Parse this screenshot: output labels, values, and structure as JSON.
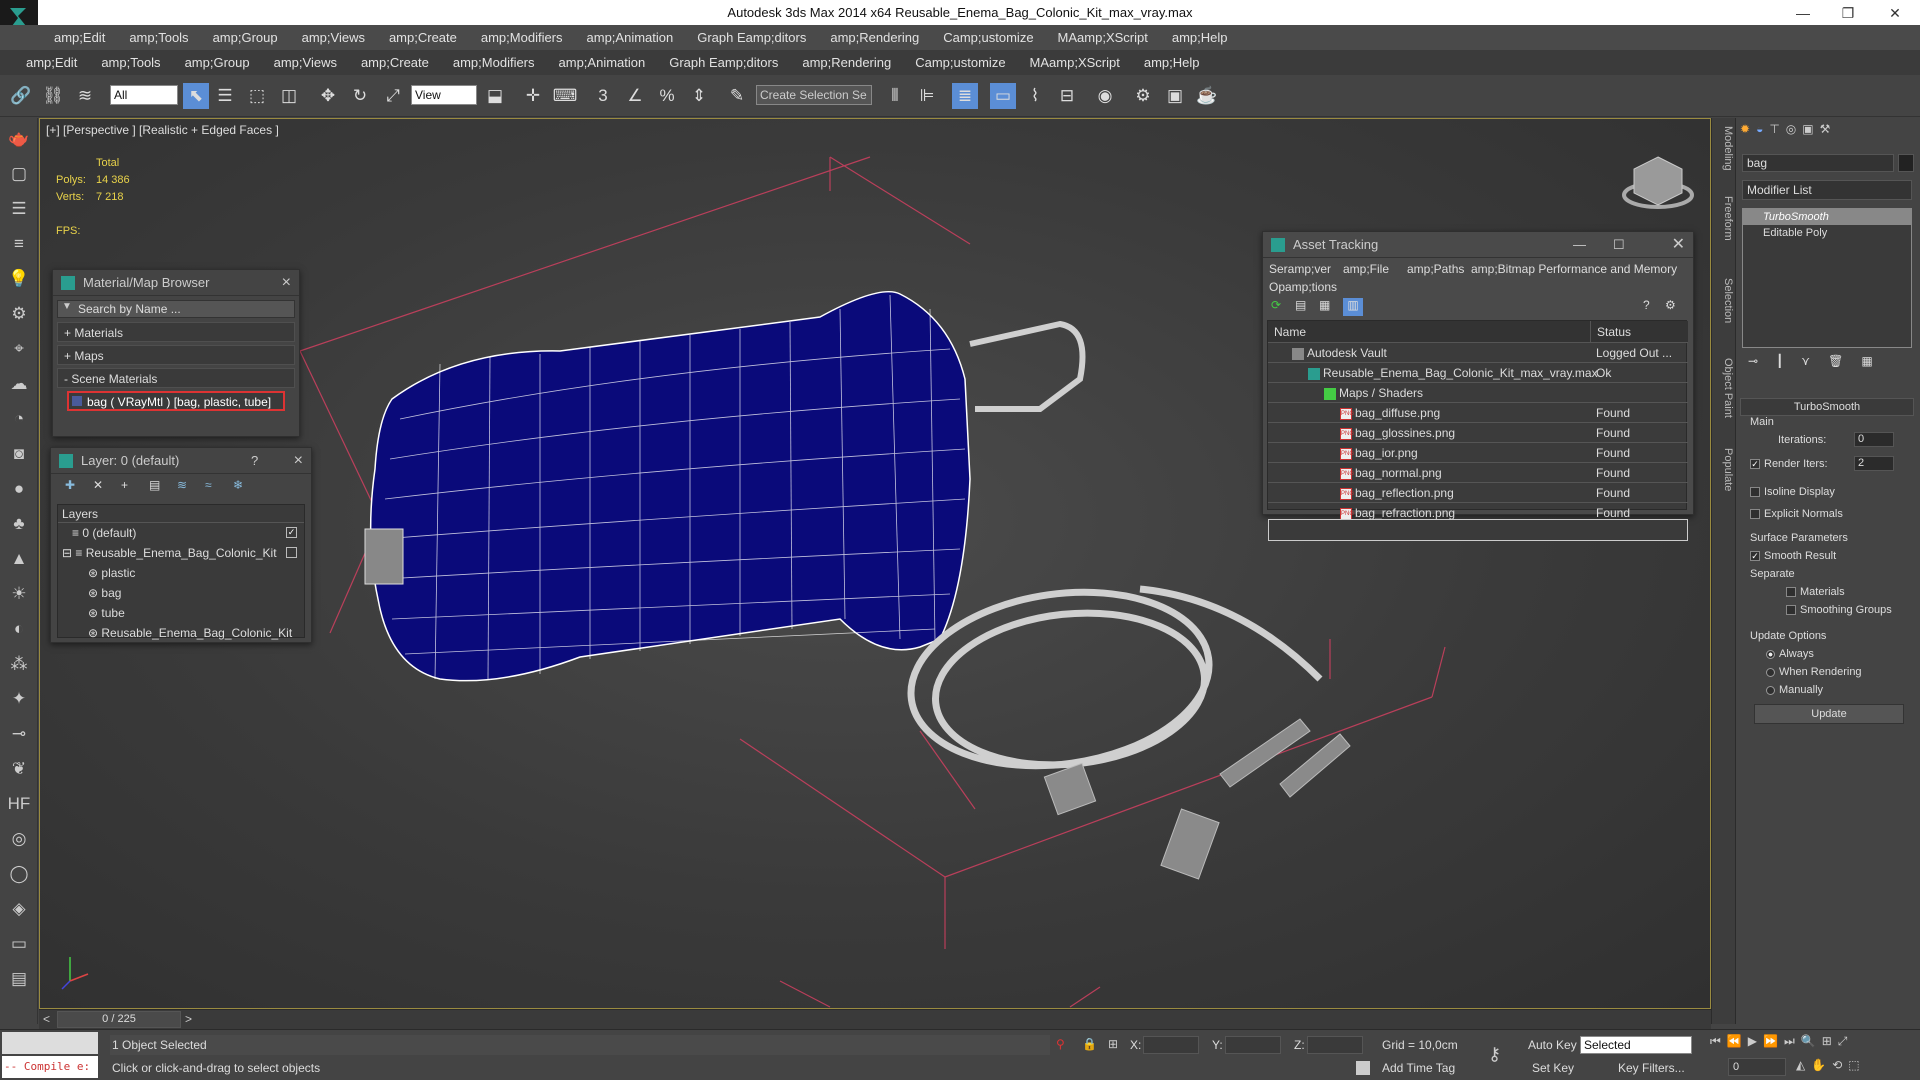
{
  "window": {
    "title": "Autodesk 3ds Max  2014 x64     Reusable_Enema_Bag_Colonic_Kit_max_vray.max",
    "minimize": "—",
    "maximize": "❐",
    "close": "✕"
  },
  "menubar1": [
    "amp;Edit",
    "amp;Tools",
    "amp;Group",
    "amp;Views",
    "amp;Create",
    "amp;Modifiers",
    "amp;Animation",
    "Graph Eamp;ditors",
    "amp;Rendering",
    "Camp;ustomize",
    "MAamp;XScript",
    "amp;Help"
  ],
  "menubar2": [
    "amp;Edit",
    "amp;Tools",
    "amp;Group",
    "amp;Views",
    "amp;Create",
    "amp;Modifiers",
    "amp;Animation",
    "Graph Eamp;ditors",
    "amp;Rendering",
    "Camp;ustomize",
    "MAamp;XScript",
    "amp;Help"
  ],
  "toolbar": {
    "selection_filter": "All",
    "ref_coord": "View",
    "named_selection": "Create Selection Se",
    "snap_3": "3",
    "snap_percent": "%"
  },
  "viewport": {
    "label": "[+] [Perspective ] [Realistic + Edged Faces ]",
    "stats_total": "Total",
    "polys_label": "Polys:",
    "polys_value": "14 386",
    "verts_label": "Verts:",
    "verts_value": "7 218",
    "fps_label": "FPS:"
  },
  "material_browser": {
    "title": "Material/Map Browser",
    "search_placeholder": "Search by Name ...",
    "materials": "+ Materials",
    "maps": "+ Maps",
    "scene_materials": "- Scene Materials",
    "material_item": "bag  ( VRayMtl )  [bag, plastic, tube]"
  },
  "layer_panel": {
    "title": "Layer: 0 (default)",
    "help": "?",
    "header": "Layers",
    "rows": [
      "0 (default)",
      "Reusable_Enema_Bag_Colonic_Kit",
      "plastic",
      "bag",
      "tube",
      "Reusable_Enema_Bag_Colonic_Kit"
    ]
  },
  "asset_tracking": {
    "title": "Asset Tracking",
    "menu": [
      "Seramp;ver",
      "amp;File",
      "amp;Paths",
      "amp;Bitmap Performance and Memory",
      "Opamp;tions"
    ],
    "col_name": "Name",
    "col_status": "Status",
    "rows": [
      {
        "name": "Autodesk Vault",
        "status": "Logged Out ..."
      },
      {
        "name": "Reusable_Enema_Bag_Colonic_Kit_max_vray.max",
        "status": "Ok"
      },
      {
        "name": "Maps / Shaders",
        "status": ""
      },
      {
        "name": "bag_diffuse.png",
        "status": "Found"
      },
      {
        "name": "bag_glossines.png",
        "status": "Found"
      },
      {
        "name": "bag_ior.png",
        "status": "Found"
      },
      {
        "name": "bag_normal.png",
        "status": "Found"
      },
      {
        "name": "bag_reflection.png",
        "status": "Found"
      },
      {
        "name": "bag_refraction.png",
        "status": "Found"
      }
    ],
    "png": "PNG"
  },
  "side_tabs": [
    "Modeling",
    "Freeform",
    "Selection",
    "Object Paint",
    "Populate"
  ],
  "command_panel": {
    "object_name": "bag",
    "modifier_list": "Modifier List",
    "stack": [
      "TurboSmooth",
      "Editable Poly"
    ],
    "rollout_title": "TurboSmooth",
    "main_group": "Main",
    "iterations_label": "Iterations:",
    "iterations_value": "0",
    "render_iters_label": "Render Iters:",
    "render_iters_value": "2",
    "isoline": "Isoline Display",
    "explicit_normals": "Explicit Normals",
    "surface_group": "Surface Parameters",
    "smooth_result": "Smooth Result",
    "separate": "Separate",
    "materials": "Materials",
    "smoothing_groups": "Smoothing Groups",
    "update_group": "Update Options",
    "always": "Always",
    "when_rendering": "When Rendering",
    "manually": "Manually",
    "update_button": "Update"
  },
  "timeline": {
    "frame": "0 / 225",
    "prev": "<",
    "next": ">"
  },
  "status": {
    "maxscript": "-- Compile e:",
    "selected": "1 Object Selected",
    "prompt": "Click or click-and-drag to select objects",
    "x_label": "X:",
    "y_label": "Y:",
    "z_label": "Z:",
    "grid": "Grid = 10,0cm",
    "add_time_tag": "Add Time Tag",
    "auto_key": "Auto Key",
    "selected_dropdown": "Selected",
    "set_key": "Set Key",
    "key_filters": "Key Filters...",
    "frame_value": "0"
  },
  "colors": {
    "bag_blue": "#0a0a7a",
    "accent_yellow": "#e8d24a",
    "grid_pink": "#d04060"
  }
}
